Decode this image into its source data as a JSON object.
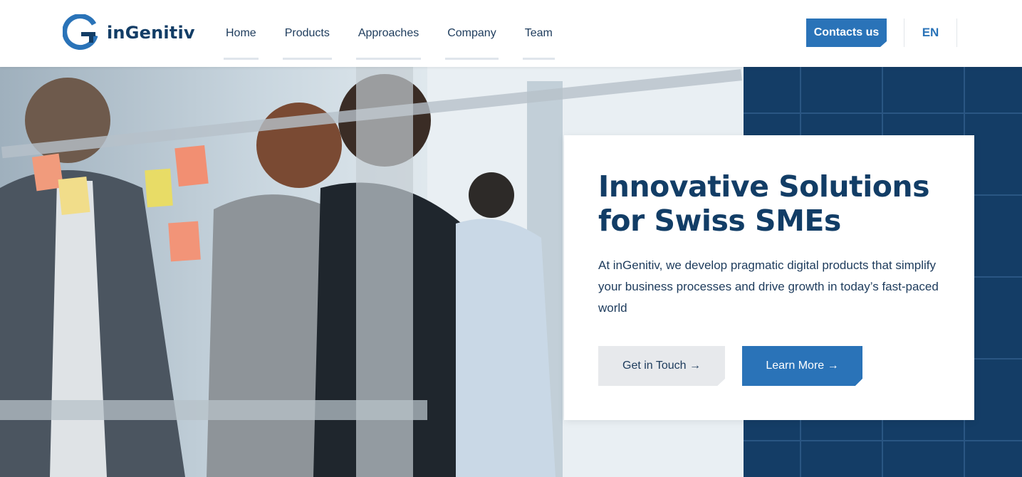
{
  "brand": {
    "name": "inGenitiv",
    "accent": "#2a73b8",
    "navy": "#123d66"
  },
  "nav": {
    "items": [
      {
        "label": "Home"
      },
      {
        "label": "Products"
      },
      {
        "label": "Approaches"
      },
      {
        "label": "Company"
      },
      {
        "label": "Team"
      }
    ],
    "contact_label": "Contacts us",
    "language": "EN"
  },
  "hero": {
    "title": "Innovative Solutions for Swiss SMEs",
    "subtitle": "At inGenitiv, we develop pragmatic digital products that simplify your business processes and drive growth in today’s fast-paced world",
    "primary_button": "Get in Touch →",
    "secondary_button": "Learn More →",
    "image_icon": "office-team-photo"
  }
}
